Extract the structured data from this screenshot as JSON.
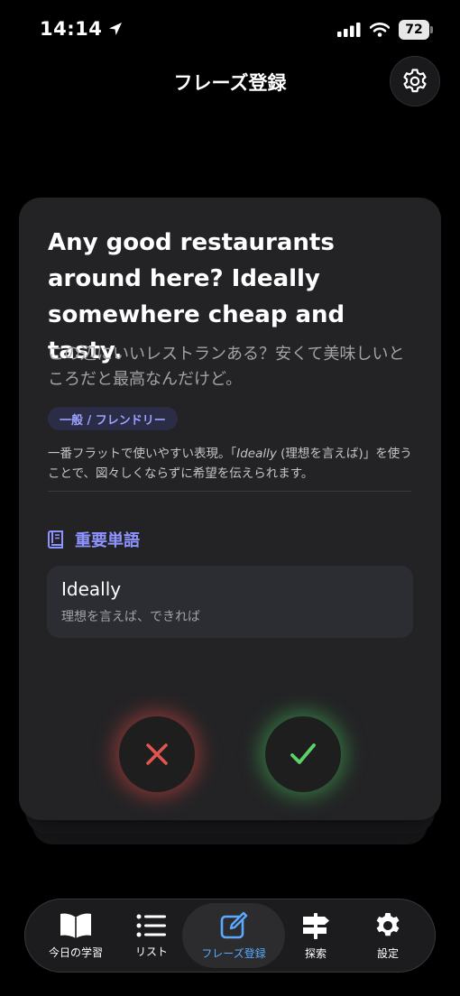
{
  "status_bar": {
    "time": "14:14",
    "battery": "72"
  },
  "header": {
    "title": "フレーズ登録"
  },
  "card": {
    "phrase_en": "Any good restaurants around here? Ideally somewhere cheap and tasty.",
    "phrase_ja": "この辺にいいレストランある？安くて美味しいところだと最高なんだけど。",
    "tag": "一般 / フレンドリー",
    "note": {
      "part1": "一番フラットで使いやすい表現。「",
      "italic": "Ideally",
      "part2": " (理想を言えば)」を使うことで、図々しくならずに希望を伝えられます。"
    },
    "vocab_title": "重要単語",
    "vocab": [
      {
        "word": "Ideally",
        "meaning": "理想を言えば、できれば"
      }
    ]
  },
  "tabbar": {
    "items": [
      {
        "label": "今日の学習",
        "icon": "book-icon"
      },
      {
        "label": "リスト",
        "icon": "list-icon"
      },
      {
        "label": "フレーズ登録",
        "icon": "edit-icon",
        "active": true
      },
      {
        "label": "探索",
        "icon": "signpost-icon"
      },
      {
        "label": "設定",
        "icon": "gear-icon"
      }
    ]
  },
  "colors": {
    "accent_blue": "#5ba9ff",
    "vocab_purple": "#8e94ff",
    "reject_red": "#e0544f",
    "accept_green": "#5cd16a"
  }
}
